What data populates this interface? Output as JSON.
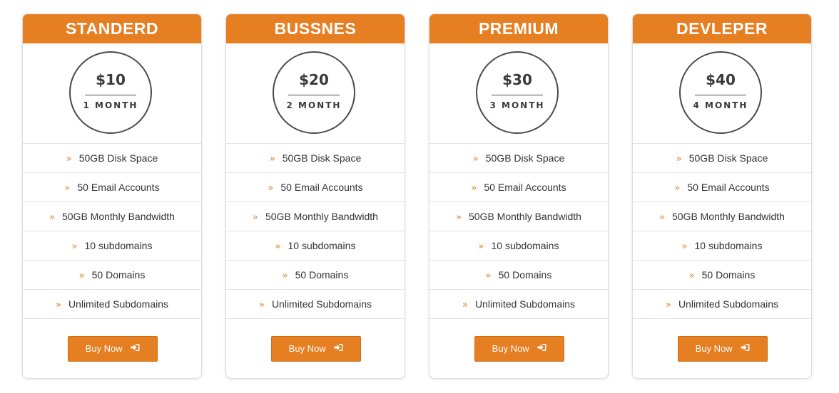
{
  "plans": [
    {
      "name": "STANDERD",
      "price": "$10",
      "period": "1 MONTH",
      "features": [
        "50GB Disk Space",
        "50 Email Accounts",
        "50GB Monthly Bandwidth",
        "10 subdomains",
        "50 Domains",
        "Unlimited Subdomains"
      ],
      "button_label": "Buy Now",
      "button_icon": "sign-in-icon"
    },
    {
      "name": "BUSSNES",
      "price": "$20",
      "period": "2 MONTH",
      "features": [
        "50GB Disk Space",
        "50 Email Accounts",
        "50GB Monthly Bandwidth",
        "10 subdomains",
        "50 Domains",
        "Unlimited Subdomains"
      ],
      "button_label": "Buy Now",
      "button_icon": "sign-in-icon"
    },
    {
      "name": "PREMIUM",
      "price": "$30",
      "period": "3 MONTH",
      "features": [
        "50GB Disk Space",
        "50 Email Accounts",
        "50GB Monthly Bandwidth",
        "10 subdomains",
        "50 Domains",
        "Unlimited Subdomains"
      ],
      "button_label": "Buy Now",
      "button_icon": "sign-in-icon"
    },
    {
      "name": "DEVLEPER",
      "price": "$40",
      "period": "4 MONTH",
      "features": [
        "50GB Disk Space",
        "50 Email Accounts",
        "50GB Monthly Bandwidth",
        "10 subdomains",
        "50 Domains",
        "Unlimited Subdomains"
      ],
      "button_label": "Buy Now",
      "button_icon": "sign-in-icon"
    }
  ],
  "feature_bullet_icon": "double-chevron-right-icon",
  "colors": {
    "accent": "#e67e22",
    "text": "#333333",
    "circle_border": "#4a4a4a",
    "divider": "#e2e2e2"
  }
}
